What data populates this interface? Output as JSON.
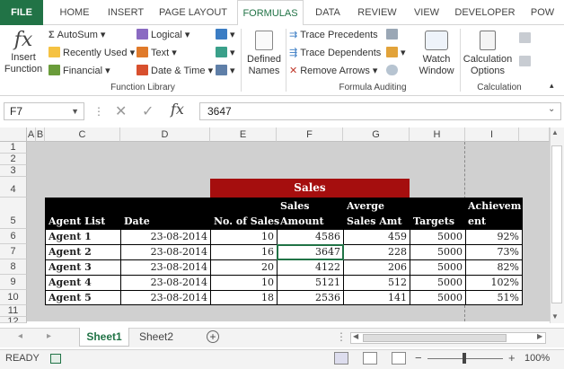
{
  "tabs": [
    "FILE",
    "HOME",
    "INSERT",
    "PAGE LAYOUT",
    "FORMULAS",
    "DATA",
    "REVIEW",
    "VIEW",
    "DEVELOPER",
    "POW"
  ],
  "ribbon": {
    "insert_function": "Insert Function",
    "fx_glyph": "fx",
    "autosum": "AutoSum",
    "recently_used": "Recently Used",
    "financial": "Financial",
    "logical": "Logical",
    "text": "Text",
    "date_time": "Date & Time",
    "function_library": "Function Library",
    "defined_names": "Defined Names",
    "trace_precedents": "Trace Precedents",
    "trace_dependents": "Trace Dependents",
    "remove_arrows": "Remove Arrows",
    "formula_auditing": "Formula Auditing",
    "watch_window": "Watch Window",
    "calculation_options": "Calculation Options",
    "calculation": "Calculation"
  },
  "formula_bar": {
    "name_box": "F7",
    "fx": "fx",
    "value": "3647"
  },
  "columns": [
    "A",
    "B",
    "C",
    "D",
    "E",
    "F",
    "G",
    "H",
    "I"
  ],
  "rows": [
    "1",
    "2",
    "3",
    "4",
    "5",
    "6",
    "7",
    "8",
    "9",
    "10",
    "11",
    "12"
  ],
  "table": {
    "title": "Sales",
    "headers": {
      "agent": "Agent List",
      "date": "Date",
      "no_sales": "No. of Sales",
      "sales_amount_1": "Sales",
      "sales_amount_2": "Amount",
      "avg_1": "Averge",
      "avg_2": "Sales Amt",
      "targets": "Targets",
      "ach_1": "Achievem",
      "ach_2": "ent"
    },
    "rows": [
      {
        "agent": "Agent 1",
        "date": "23-08-2014",
        "no": "10",
        "amount": "4586",
        "avg": "459",
        "target": "5000",
        "ach": "92%"
      },
      {
        "agent": "Agent 2",
        "date": "23-08-2014",
        "no": "16",
        "amount": "3647",
        "avg": "228",
        "target": "5000",
        "ach": "73%"
      },
      {
        "agent": "Agent 3",
        "date": "23-08-2014",
        "no": "20",
        "amount": "4122",
        "avg": "206",
        "target": "5000",
        "ach": "82%"
      },
      {
        "agent": "Agent 4",
        "date": "23-08-2014",
        "no": "10",
        "amount": "5121",
        "avg": "512",
        "target": "5000",
        "ach": "102%"
      },
      {
        "agent": "Agent 5",
        "date": "23-08-2014",
        "no": "18",
        "amount": "2536",
        "avg": "141",
        "target": "5000",
        "ach": "51%"
      }
    ]
  },
  "sheets": [
    "Sheet1",
    "Sheet2"
  ],
  "status": {
    "ready": "READY",
    "zoom": "100%"
  },
  "colors": {
    "excel_green": "#217346",
    "title_red": "#a50e0e",
    "header_black": "#000000",
    "grey_background": "#d0d0d0"
  }
}
